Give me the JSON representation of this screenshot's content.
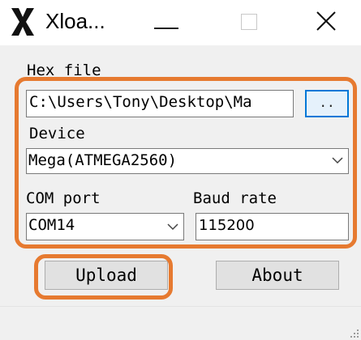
{
  "window": {
    "title": "Xloa...",
    "icons": {
      "app": "xloader-x-icon",
      "minimize": "minimize-icon",
      "maximize": "maximize-icon",
      "close": "close-icon"
    }
  },
  "hex_file": {
    "label": "Hex file",
    "path": "C:\\Users\\Tony\\Desktop\\Ma",
    "browse_label": ".."
  },
  "device": {
    "label": "Device",
    "selected": "Mega(ATMEGA2560)"
  },
  "com_port": {
    "label": "COM port",
    "selected": "COM14"
  },
  "baud_rate": {
    "label": "Baud rate",
    "value": "115200"
  },
  "buttons": {
    "upload": "Upload",
    "about": "About"
  },
  "colors": {
    "highlight": "#e67a30",
    "focus_border": "#0078d7",
    "window_bg": "#f0f0f0"
  }
}
